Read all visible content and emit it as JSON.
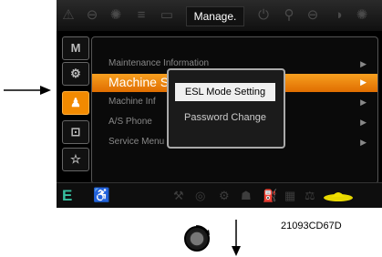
{
  "topbar": {
    "title": "Manage.",
    "left_icons": [
      "warning-icon",
      "lamp-icon",
      "sun-icon",
      "light-icon",
      "battery-icon"
    ],
    "right_icons": [
      "power-icon",
      "key-icon",
      "lamp-icon",
      "circle-icon",
      "sun-icon"
    ]
  },
  "tabs": [
    {
      "icon": "M",
      "name": "tab-m",
      "active": false
    },
    {
      "icon": "⚙",
      "name": "tab-gear",
      "active": false
    },
    {
      "icon": "♟",
      "name": "tab-person",
      "active": true
    },
    {
      "icon": "📺",
      "name": "tab-monitor",
      "active": false
    },
    {
      "icon": "☆",
      "name": "tab-star",
      "active": false
    }
  ],
  "menu": {
    "items": [
      {
        "label": "Maintenance Information"
      },
      {
        "label": "Machine S"
      },
      {
        "label": "Machine Inf"
      },
      {
        "label": "A/S Phone"
      },
      {
        "label": "Service Menu"
      }
    ],
    "arrow": "▶"
  },
  "popup": {
    "items": [
      "ESL Mode Setting",
      "Password Change"
    ]
  },
  "bottombar": {
    "e_label": "E"
  },
  "reference": "21093CD67D"
}
